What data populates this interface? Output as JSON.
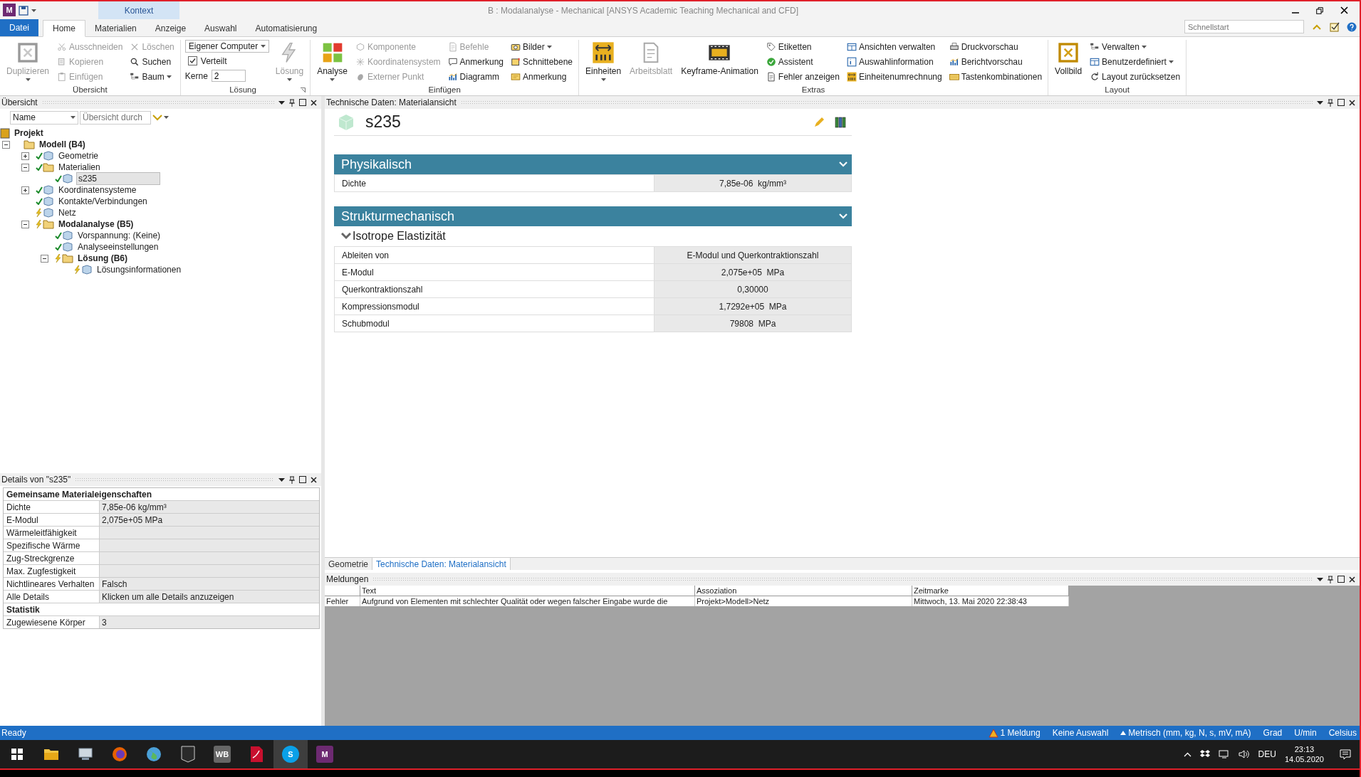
{
  "title_bar": {
    "app_icon": "M",
    "context_tab": "Kontext",
    "title": "B : Modalanalyse - Mechanical [ANSYS Academic Teaching Mechanical and CFD]"
  },
  "menu_tabs": [
    {
      "label": "Datei",
      "kind": "file",
      "selected": false
    },
    {
      "label": "Home",
      "kind": "tab",
      "selected": true
    },
    {
      "label": "Materialien",
      "kind": "tab",
      "selected": false
    },
    {
      "label": "Anzeige",
      "kind": "tab",
      "selected": false
    },
    {
      "label": "Auswahl",
      "kind": "tab",
      "selected": false
    },
    {
      "label": "Automatisierung",
      "kind": "tab",
      "selected": false
    }
  ],
  "quick_launch": {
    "placeholder": "Schnellstart"
  },
  "ribbon": [
    {
      "label": "Übersicht",
      "launcher": false,
      "items": [
        {
          "kind": "large",
          "label": "Duplizieren",
          "disabled": true,
          "dropdown": true
        },
        {
          "kind": "small",
          "label": "Ausschneiden",
          "disabled": true,
          "dropdown": false
        },
        {
          "kind": "small",
          "label": "Kopieren",
          "disabled": true,
          "dropdown": false
        },
        {
          "kind": "small",
          "label": "Einfügen",
          "disabled": true,
          "dropdown": false
        },
        {
          "kind": "small",
          "label": "Löschen",
          "disabled": true,
          "dropdown": false
        },
        {
          "kind": "small",
          "label": "Suchen",
          "disabled": false,
          "dropdown": false
        },
        {
          "kind": "small",
          "label": "Baum",
          "disabled": false,
          "dropdown": true
        }
      ]
    },
    {
      "label": "Lösung",
      "launcher": true,
      "items": [
        {
          "kind": "select",
          "value": "Eigener Computer"
        },
        {
          "kind": "checkbox",
          "label": "Verteilt",
          "checked": true
        },
        {
          "kind": "field",
          "label": "Kerne",
          "value": "2"
        },
        {
          "kind": "large",
          "label": "Lösung",
          "disabled": true,
          "dropdown": true
        }
      ]
    },
    {
      "label": "Einfügen",
      "launcher": false,
      "items": [
        {
          "kind": "large",
          "label": "Analyse",
          "disabled": false,
          "dropdown": true
        },
        {
          "kind": "small",
          "label": "Komponente",
          "disabled": true,
          "dropdown": false
        },
        {
          "kind": "small",
          "label": "Koordinatensystem",
          "disabled": true,
          "dropdown": false
        },
        {
          "kind": "small",
          "label": "Externer Punkt",
          "disabled": true,
          "dropdown": false
        },
        {
          "kind": "small",
          "label": "Befehle",
          "disabled": true,
          "dropdown": false
        },
        {
          "kind": "small",
          "label": "Anmerkung",
          "disabled": false,
          "dropdown": false
        },
        {
          "kind": "small",
          "label": "Diagramm",
          "disabled": false,
          "dropdown": false
        },
        {
          "kind": "small",
          "label": "Bilder",
          "disabled": false,
          "dropdown": true
        },
        {
          "kind": "small",
          "label": "Schnittebene",
          "disabled": false,
          "dropdown": false
        },
        {
          "kind": "small",
          "label": "Anmerkung",
          "disabled": false,
          "dropdown": false
        }
      ]
    },
    {
      "label": "Extras",
      "launcher": false,
      "items": [
        {
          "kind": "large",
          "label": "Einheiten",
          "disabled": false,
          "dropdown": true
        },
        {
          "kind": "large",
          "label": "Arbeitsblatt",
          "disabled": true,
          "dropdown": false
        },
        {
          "kind": "large",
          "label": "Keyframe-Animation",
          "disabled": false,
          "dropdown": false
        },
        {
          "kind": "small",
          "label": "Etiketten",
          "disabled": false,
          "dropdown": false
        },
        {
          "kind": "small",
          "label": "Assistent",
          "disabled": false,
          "dropdown": false
        },
        {
          "kind": "small",
          "label": "Fehler anzeigen",
          "disabled": false,
          "dropdown": false
        },
        {
          "kind": "small",
          "label": "Ansichten verwalten",
          "disabled": false,
          "dropdown": false
        },
        {
          "kind": "small",
          "label": "Auswahlinformation",
          "disabled": false,
          "dropdown": false
        },
        {
          "kind": "small",
          "label": "Einheitenumrechnung",
          "disabled": false,
          "dropdown": false
        },
        {
          "kind": "small",
          "label": "Druckvorschau",
          "disabled": false,
          "dropdown": false
        },
        {
          "kind": "small",
          "label": "Berichtvorschau",
          "disabled": false,
          "dropdown": false
        },
        {
          "kind": "small",
          "label": "Tastenkombinationen",
          "disabled": false,
          "dropdown": false
        }
      ]
    },
    {
      "label": "Layout",
      "launcher": false,
      "items": [
        {
          "kind": "large",
          "label": "Vollbild",
          "disabled": false,
          "dropdown": false
        },
        {
          "kind": "small",
          "label": "Verwalten",
          "disabled": false,
          "dropdown": true
        },
        {
          "kind": "small",
          "label": "Benutzerdefiniert",
          "disabled": false,
          "dropdown": true
        },
        {
          "kind": "small",
          "label": "Layout zurücksetzen",
          "disabled": false,
          "dropdown": false
        }
      ]
    }
  ],
  "outline": {
    "title": "Übersicht",
    "filter": {
      "value": "Name"
    },
    "search": {
      "placeholder": "Übersicht durch"
    },
    "tree": [
      {
        "label": "Projekt",
        "bold": true,
        "selected": false,
        "children": [
          {
            "label": "Modell (B4)",
            "bold": true,
            "selected": false,
            "expanded": true,
            "children": [
              {
                "label": "Geometrie",
                "bold": false,
                "selected": false,
                "expanded": false,
                "kind": "ok"
              },
              {
                "label": "Materialien",
                "bold": false,
                "selected": false,
                "expanded": true,
                "kind": "ok",
                "children": [
                  {
                    "label": "s235",
                    "bold": false,
                    "selected": true,
                    "kind": "ok"
                  }
                ]
              },
              {
                "label": "Koordinatensysteme",
                "bold": false,
                "selected": false,
                "expanded": false,
                "kind": "ok"
              },
              {
                "label": "Kontakte/Verbindungen",
                "bold": false,
                "selected": false,
                "kind": "ok"
              },
              {
                "label": "Netz",
                "bold": false,
                "selected": false,
                "kind": "pending"
              },
              {
                "label": "Modalanalyse (B5)",
                "bold": true,
                "selected": false,
                "expanded": true,
                "kind": "pending",
                "children": [
                  {
                    "label": "Vorspannung: (Keine)",
                    "bold": false,
                    "selected": false,
                    "kind": "ok"
                  },
                  {
                    "label": "Analyseeinstellungen",
                    "bold": false,
                    "selected": false,
                    "kind": "ok"
                  },
                  {
                    "label": "Lösung (B6)",
                    "bold": true,
                    "selected": false,
                    "expanded": true,
                    "kind": "pending",
                    "children": [
                      {
                        "label": "Lösungsinformationen",
                        "bold": false,
                        "selected": false,
                        "kind": "pending"
                      }
                    ]
                  }
                ]
              }
            ]
          }
        ]
      }
    ]
  },
  "details": {
    "title": "Details von \"s235\"",
    "sections": [
      {
        "title": "Gemeinsame Materialeigenschaften",
        "rows": [
          {
            "label": "Dichte",
            "value": "7,85e-06 kg/mm³"
          },
          {
            "label": "E-Modul",
            "value": "2,075e+05 MPa"
          },
          {
            "label": "Wärmeleitfähigkeit"
          },
          {
            "label": "Spezifische Wärme"
          },
          {
            "label": "Zug-Streckgrenze"
          },
          {
            "label": "Max. Zugfestigkeit"
          },
          {
            "label": "Nichtlineares Verhalten",
            "value": "Falsch"
          },
          {
            "label": "Alle Details",
            "value": "Klicken um alle Details anzuzeigen"
          }
        ]
      },
      {
        "title": "Statistik",
        "rows": [
          {
            "label": "Zugewiesene Körper",
            "value": "3"
          }
        ]
      }
    ]
  },
  "material_view": {
    "title": "Technische Daten: Materialansicht",
    "material": "s235",
    "sections": [
      {
        "title": "Physikalisch",
        "groups": [
          {
            "rows": [
              {
                "label": "Dichte",
                "value": "7,85e-06  kg/mm³"
              }
            ]
          }
        ]
      },
      {
        "title": "Strukturmechanisch",
        "groups": [
          {
            "title": "Isotrope Elastizität",
            "rows": [
              {
                "label": "Ableiten von",
                "value": "E-Modul und Querkontraktionszahl"
              },
              {
                "label": "E-Modul",
                "value": "2,075e+05  MPa"
              },
              {
                "label": "Querkontraktionszahl",
                "value": "0,30000"
              },
              {
                "label": "Kompressionsmodul",
                "value": "1,7292e+05  MPa"
              },
              {
                "label": "Schubmodul",
                "value": "79808  MPa"
              }
            ]
          }
        ]
      }
    ]
  },
  "view_tabs": [
    {
      "label": "Geometrie",
      "selected": false
    },
    {
      "label": "Technische Daten: Materialansicht",
      "selected": true
    }
  ],
  "messages": {
    "title": "Meldungen",
    "columns": [
      "Text",
      "Assoziation",
      "Zeitmarke"
    ],
    "rows": [
      {
        "type": "Fehler",
        "text": "Aufgrund von Elementen mit schlechter Qualität oder wegen falscher Eingabe wurde die",
        "association": "Projekt>Modell>Netz",
        "timestamp": "Mittwoch, 13. Mai 2020 22:38:43"
      }
    ]
  },
  "status_bar": {
    "left": "Ready",
    "messages": "1 Meldung",
    "selection": "Keine Auswahl",
    "unit_system": "Metrisch (mm, kg, N, s, mV, mA)",
    "angle": "Grad",
    "rotation": "U/min",
    "temperature": "Celsius"
  },
  "taskbar": {
    "apps": [
      {
        "kind": "start",
        "highlighted": false
      },
      {
        "kind": "explorer",
        "highlighted": false
      },
      {
        "kind": "computer",
        "highlighted": false
      },
      {
        "kind": "firefox",
        "highlighted": false
      },
      {
        "kind": "globe",
        "highlighted": false
      },
      {
        "kind": "epic",
        "highlighted": false
      },
      {
        "kind": "letter",
        "label": "WB",
        "highlighted": false
      },
      {
        "kind": "pdf",
        "highlighted": false
      },
      {
        "kind": "letter",
        "label": "S",
        "highlighted": true
      },
      {
        "kind": "letter",
        "label": "M",
        "highlighted": false
      }
    ],
    "language": "DEU",
    "time": "23:13",
    "date": "14.05.2020"
  }
}
